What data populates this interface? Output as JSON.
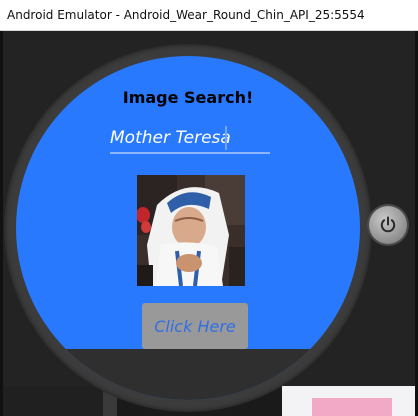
{
  "window": {
    "title": "Android Emulator - Android_Wear_Round_Chin_API_25:5554"
  },
  "app": {
    "title": "Image Search!",
    "search_value": "Mother Teresa",
    "button_label": "Click Here",
    "image_alt_subject": "Mother Teresa"
  },
  "icons": {
    "power": "power-icon"
  },
  "colors": {
    "screen_bg": "#2979ff",
    "button_bg": "#999999",
    "button_text": "#2f6fe6"
  }
}
